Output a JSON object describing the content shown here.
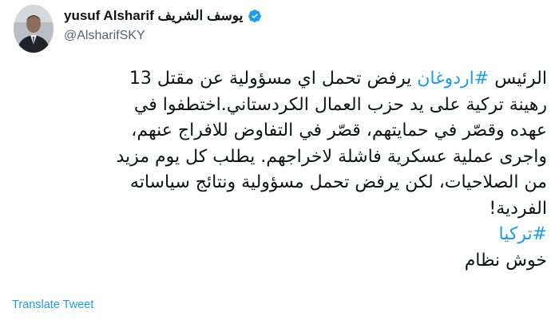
{
  "author": {
    "name": "yusuf Alsharif يوسف الشريف",
    "handle": "@AlsharifSKY",
    "verified_icon": "verified-badge-icon",
    "avatar_icon": "avatar"
  },
  "tweet": {
    "line1_pre": "الرئيس ",
    "line1_tag": "#اردوغان",
    "line1_post": " يرفض تحمل اي مسؤولية عن مقتل 13",
    "line2": "رهينة تركية على يد حزب العمال الكردستاني.اختطفوا في",
    "line3": "عهده وقصّر في حمايتهم، قصّر في التفاوض للافراج عنهم،",
    "line4": "واجرى عملية عسكرية فاشلة لاخراجهم. يطلب كل يوم مزيد",
    "line5": "من الصلاحيات، لكن يرفض تحمل مسؤولية ونتائج سياساته",
    "line6": "الفردية!",
    "line7_tag": "#تركيا",
    "line8": "خوش نظام"
  },
  "actions": {
    "translate_label": "Translate Tweet"
  },
  "colors": {
    "link": "#1d9bf0",
    "text": "#0f1419",
    "muted": "#536471"
  }
}
